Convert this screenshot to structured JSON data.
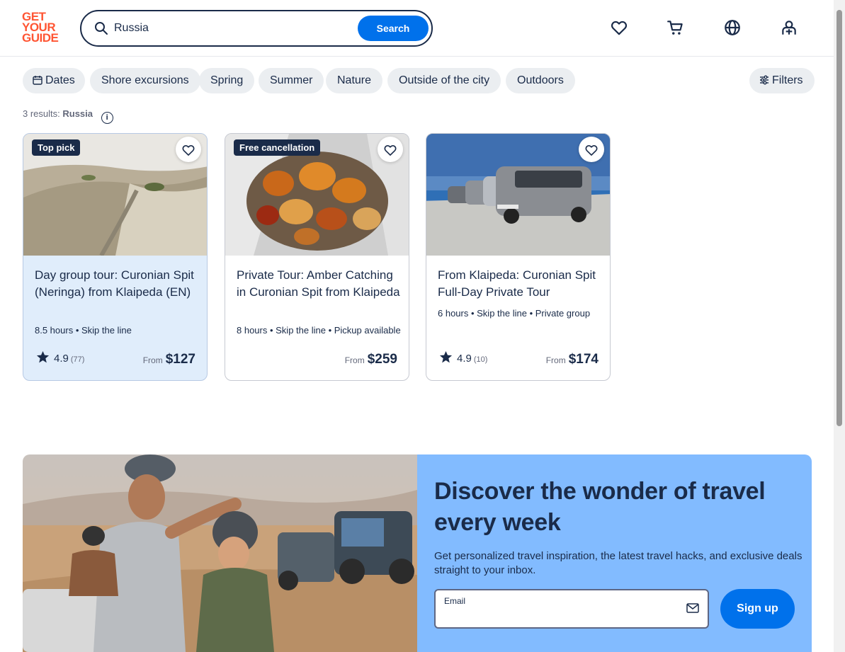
{
  "header": {
    "logo_lines": [
      "GET",
      "YOUR",
      "GUIDE"
    ],
    "search_value": "Russia",
    "search_button": "Search",
    "icons": [
      "heart-icon",
      "cart-icon",
      "globe-icon",
      "profile-icon"
    ]
  },
  "filters": {
    "chips": [
      "Dates",
      "Shore excursions",
      "Spring",
      "Summer",
      "Nature",
      "Outside of the city",
      "Outdoors"
    ],
    "filters_button": "Filters"
  },
  "results": {
    "count_text": "3 results:",
    "query": "Russia"
  },
  "cards": [
    {
      "badge": "Top pick",
      "title": "Day group tour: Curonian Spit (Neringa) from Klaipeda (EN)",
      "meta": "8.5 hours • Skip the line",
      "rating": "4.9",
      "reviews": "(77)",
      "from_label": "From",
      "price": "$127"
    },
    {
      "badge": "Free cancellation",
      "title": "Private Tour: Amber Catching in Curonian Spit from Klaipeda",
      "meta": "8 hours • Skip the line • Pickup available",
      "rating": "",
      "reviews": "",
      "from_label": "From",
      "price": "$259"
    },
    {
      "badge": "",
      "title": "From Klaipeda: Curonian Spit Full-Day Private Tour",
      "meta": "6 hours • Skip the line • Private group",
      "rating": "4.9",
      "reviews": "(10)",
      "from_label": "From",
      "price": "$174"
    }
  ],
  "newsletter": {
    "headline": "Discover the wonder of travel every week",
    "body": "Get personalized travel inspiration, the latest travel hacks, and exclusive deals straight to your inbox.",
    "email_label": "Email",
    "email_value": "",
    "signup_button": "Sign up"
  },
  "colors": {
    "brand": "#ff5533",
    "accent": "#0071eb",
    "navy": "#1a2b49",
    "promo_panel": "#82bbff",
    "highlight_card": "#e0edfb"
  }
}
